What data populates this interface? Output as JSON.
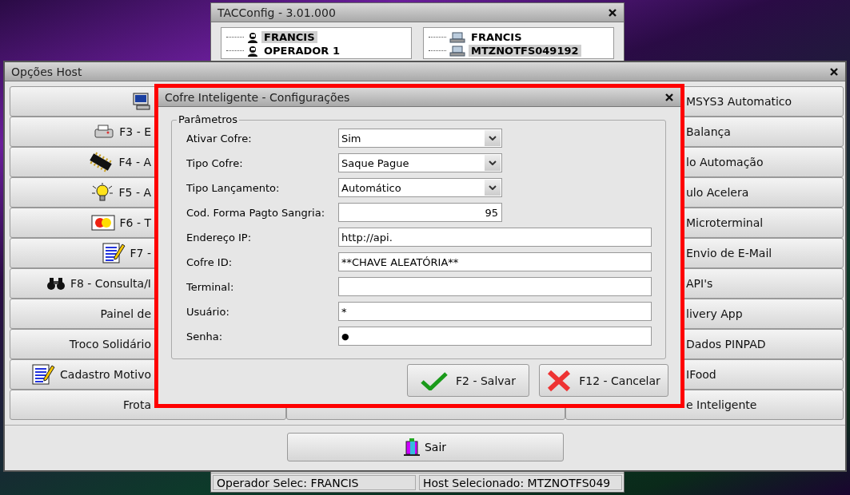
{
  "tacconfig": {
    "title": "TACConfig  - 3.01.000",
    "operators": [
      {
        "label": "FRANCIS",
        "selected": true
      },
      {
        "label": "OPERADOR 1",
        "selected": false
      }
    ],
    "hosts": [
      {
        "label": "FRANCIS",
        "selected": false
      },
      {
        "label": "MTZNOTFS049192",
        "selected": true
      }
    ],
    "status_bar": [
      "Operador Selec: FRANCIS",
      "Host Selecionado: MTZNOTFS049"
    ]
  },
  "options_window": {
    "title": "Opções Host",
    "rows": [
      {
        "left": {
          "kind": "monitor"
        },
        "right": {
          "label": "MSYS3 Automatico"
        }
      },
      {
        "left": {
          "label": "F3 - E",
          "kind": "printer"
        },
        "right": {
          "label": "Balança"
        }
      },
      {
        "left": {
          "label": "F4 - A",
          "kind": "chip"
        },
        "right": {
          "label": "lo Automação"
        }
      },
      {
        "left": {
          "label": "F5 - A",
          "kind": "bulb"
        },
        "right": {
          "label": "ulo Acelera"
        }
      },
      {
        "left": {
          "label": "F6 - T",
          "kind": "card"
        },
        "right": {
          "label": "Microterminal"
        }
      },
      {
        "left": {
          "label": "F7 -",
          "kind": "notepad"
        },
        "right": {
          "label": "Envio de E-Mail"
        }
      },
      {
        "left": {
          "label": "F8 - Consulta/I",
          "kind": "binoculars"
        },
        "right": {
          "label": "API's"
        }
      },
      {
        "left": {
          "label": "Painel de"
        },
        "right": {
          "label": "livery App"
        }
      },
      {
        "left": {
          "label": "Troco Solidário"
        },
        "right": {
          "label": "Dados PINPAD"
        }
      },
      {
        "left": {
          "label": "Cadastro Motivo",
          "kind": "notepad"
        },
        "right": {
          "label": "IFood"
        }
      },
      {
        "left": {
          "label": "Frota"
        },
        "right": {
          "label": "e Inteligente"
        }
      }
    ],
    "exit_button": "Sair"
  },
  "dialog": {
    "title": "Cofre Inteligente - Configurações",
    "group_title": "Parâmetros",
    "fields": [
      {
        "label": "Ativar Cofre:",
        "kind": "combo",
        "value": "Sim"
      },
      {
        "label": "Tipo Cofre:",
        "kind": "combo",
        "value": "Saque Pague"
      },
      {
        "label": "Tipo Lançamento:",
        "kind": "combo",
        "value": "Automático"
      },
      {
        "label": "Cod. Forma Pagto Sangria:",
        "kind": "number",
        "value": "95"
      },
      {
        "label": "Endereço IP:",
        "kind": "text",
        "value": "http://api."
      },
      {
        "label": "Cofre ID:",
        "kind": "text",
        "value": "**CHAVE ALEATÓRIA**"
      },
      {
        "label": "Terminal:",
        "kind": "text"
      },
      {
        "label": "Usuário:",
        "kind": "text",
        "value": "*"
      },
      {
        "label": "Senha:",
        "kind": "password",
        "value": "●"
      }
    ],
    "buttons": [
      {
        "label": "F2 - Salvar",
        "kind": "save"
      },
      {
        "label": "F12 - Cancelar",
        "kind": "cancel"
      }
    ]
  }
}
